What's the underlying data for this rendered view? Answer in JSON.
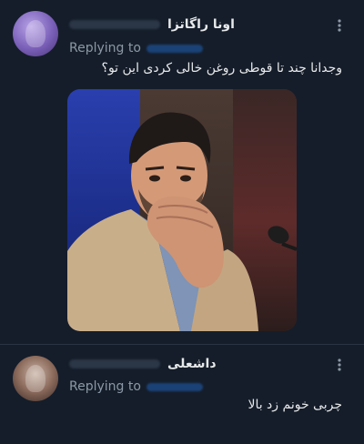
{
  "tweets": [
    {
      "author_name": "اونا راگاتزا",
      "replying_label": "Replying to",
      "text": "وجدانا چند تا قوطی روغن خالی کردی این تو؟",
      "has_media": true
    },
    {
      "author_name": "داشعلی",
      "replying_label": "Replying to",
      "text": "چربی خونم زد بالا",
      "has_media": false
    }
  ],
  "icons": {
    "more": "more-vertical-icon"
  },
  "colors": {
    "background": "#151d2a",
    "text_primary": "#e7e9ea",
    "text_secondary": "#8b98a5",
    "link_blur": "#1d4c8a"
  }
}
